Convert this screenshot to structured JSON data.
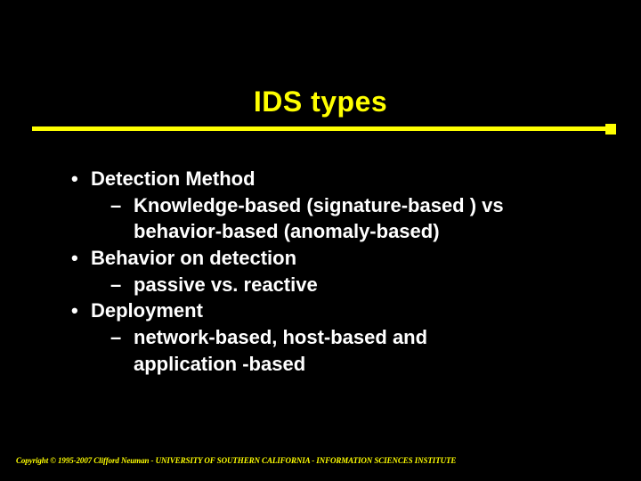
{
  "title": "IDS types",
  "bullets": {
    "b0": "Detection Method",
    "b0s0a": "Knowledge-based (signature-based ) vs",
    "b0s0b": "behavior-based (anomaly-based)",
    "b1": "Behavior on detection",
    "b1s0": "passive  vs. reactive",
    "b2": "Deployment",
    "b2s0a": "network-based, host-based and",
    "b2s0b": "application -based"
  },
  "footer": "Copyright © 1995-2007 Clifford Neuman - UNIVERSITY OF SOUTHERN CALIFORNIA - INFORMATION SCIENCES INSTITUTE",
  "colors": {
    "accent": "#ffff00",
    "bg": "#000000",
    "text": "#ffffff"
  }
}
